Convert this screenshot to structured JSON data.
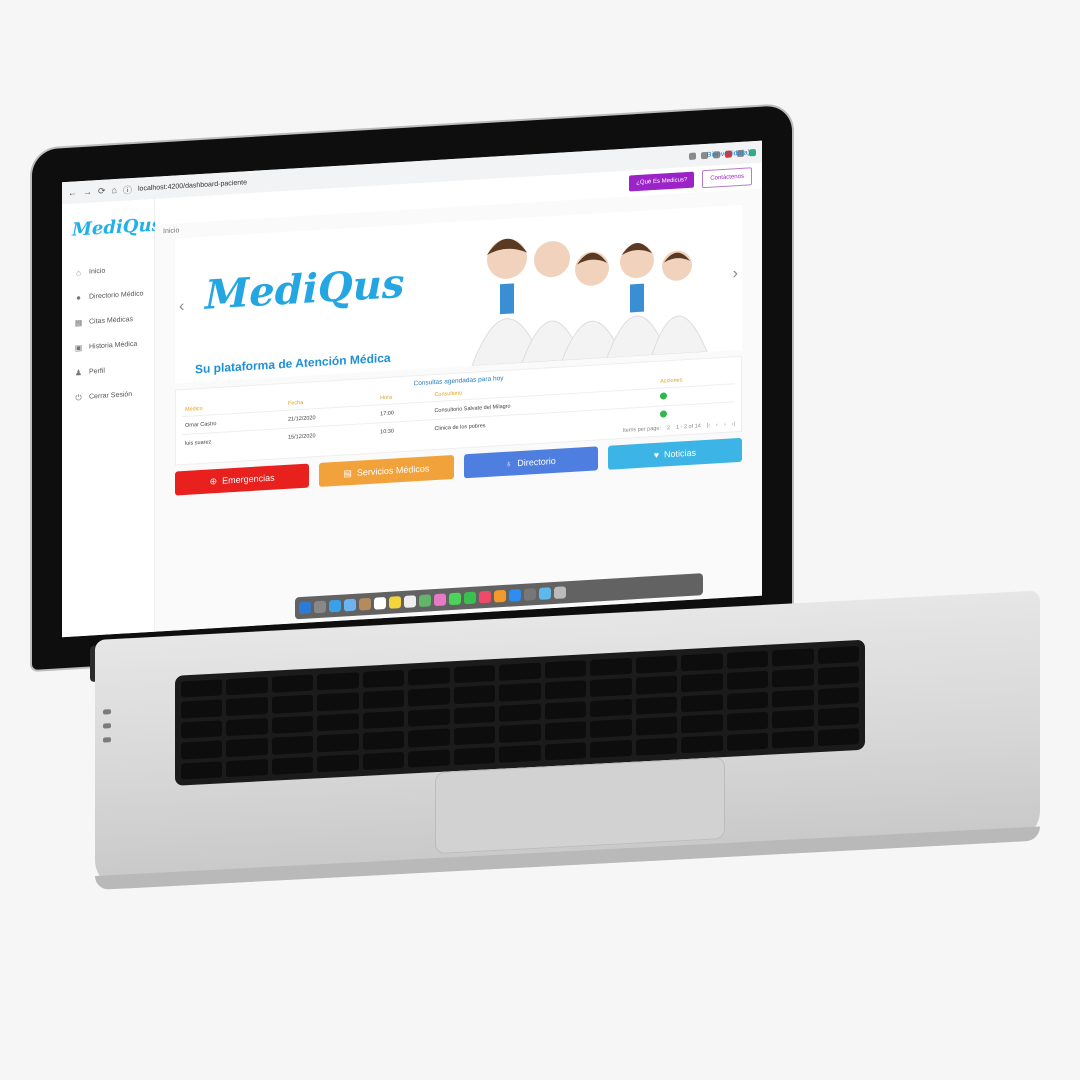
{
  "browser": {
    "url": "localhost:4200/dashboard-paciente"
  },
  "header": {
    "welcome": "Bienvenido(a)",
    "what_button": "¿Qué Es Medicus?",
    "contact_button": "Contáctenos"
  },
  "sidebar": {
    "logo": "MediQus",
    "items": [
      {
        "label": "Inicio",
        "icon": "home-icon"
      },
      {
        "label": "Directorio Médico",
        "icon": "chat-icon"
      },
      {
        "label": "Citas Médicas",
        "icon": "calendar-icon"
      },
      {
        "label": "Historia Médica",
        "icon": "folder-icon"
      },
      {
        "label": "Perfil",
        "icon": "user-icon"
      },
      {
        "label": "Cerrar Sesión",
        "icon": "power-icon"
      }
    ]
  },
  "main": {
    "breadcrumb": "Inicio",
    "hero": {
      "logo": "MediQus",
      "tagline": "Su plataforma de Atención Médica"
    },
    "table": {
      "title": "Consultas agendadas para hoy",
      "headers": [
        "Médico",
        "Fecha",
        "Hora",
        "Consultorio",
        "Acciones"
      ],
      "rows": [
        [
          "Omar Castro",
          "21/12/2020",
          "17:00",
          "Consultorio Salvate del Milagro"
        ],
        [
          "luis suarez",
          "15/12/2020",
          "10:30",
          "Clinica de los pobres"
        ]
      ],
      "pager": {
        "items_per_page": "Items per page:",
        "page_size": "2",
        "range": "1 - 2 of 14"
      }
    },
    "tiles": [
      {
        "label": "Emergencias",
        "color": "#e8201e"
      },
      {
        "label": "Servicios Médicos",
        "color": "#f2a23a"
      },
      {
        "label": "Directorio",
        "color": "#4e7ee0"
      },
      {
        "label": "Noticias",
        "color": "#3db4e6"
      }
    ]
  }
}
